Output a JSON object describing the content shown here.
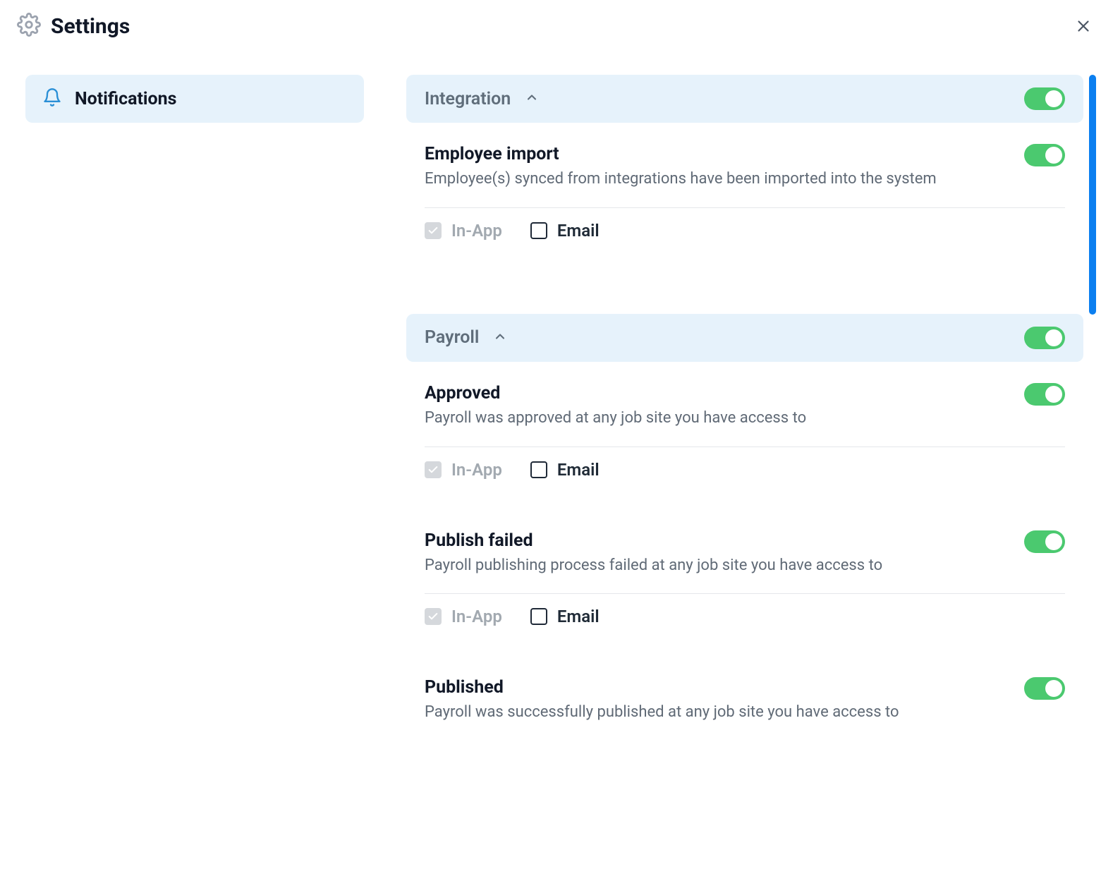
{
  "header": {
    "title": "Settings"
  },
  "sidebar": {
    "items": [
      {
        "label": "Notifications"
      }
    ]
  },
  "channels": {
    "in_app": "In-App",
    "email": "Email"
  },
  "sections": [
    {
      "title": "Integration",
      "expanded": true,
      "enabled": true,
      "items": [
        {
          "title": "Employee import",
          "desc": "Employee(s) synced from integrations have been imported into the system",
          "enabled": true,
          "in_app_checked": true,
          "in_app_disabled": true,
          "email_checked": false
        }
      ]
    },
    {
      "title": "Payroll",
      "expanded": true,
      "enabled": true,
      "items": [
        {
          "title": "Approved",
          "desc": "Payroll was approved at any job site you have access to",
          "enabled": true,
          "in_app_checked": true,
          "in_app_disabled": true,
          "email_checked": false
        },
        {
          "title": "Publish failed",
          "desc": "Payroll publishing process failed at any job site you have access to",
          "enabled": true,
          "in_app_checked": true,
          "in_app_disabled": true,
          "email_checked": false
        },
        {
          "title": "Published",
          "desc": "Payroll was successfully published at any job site you have access to",
          "enabled": true,
          "in_app_checked": true,
          "in_app_disabled": true,
          "email_checked": false
        }
      ]
    }
  ]
}
